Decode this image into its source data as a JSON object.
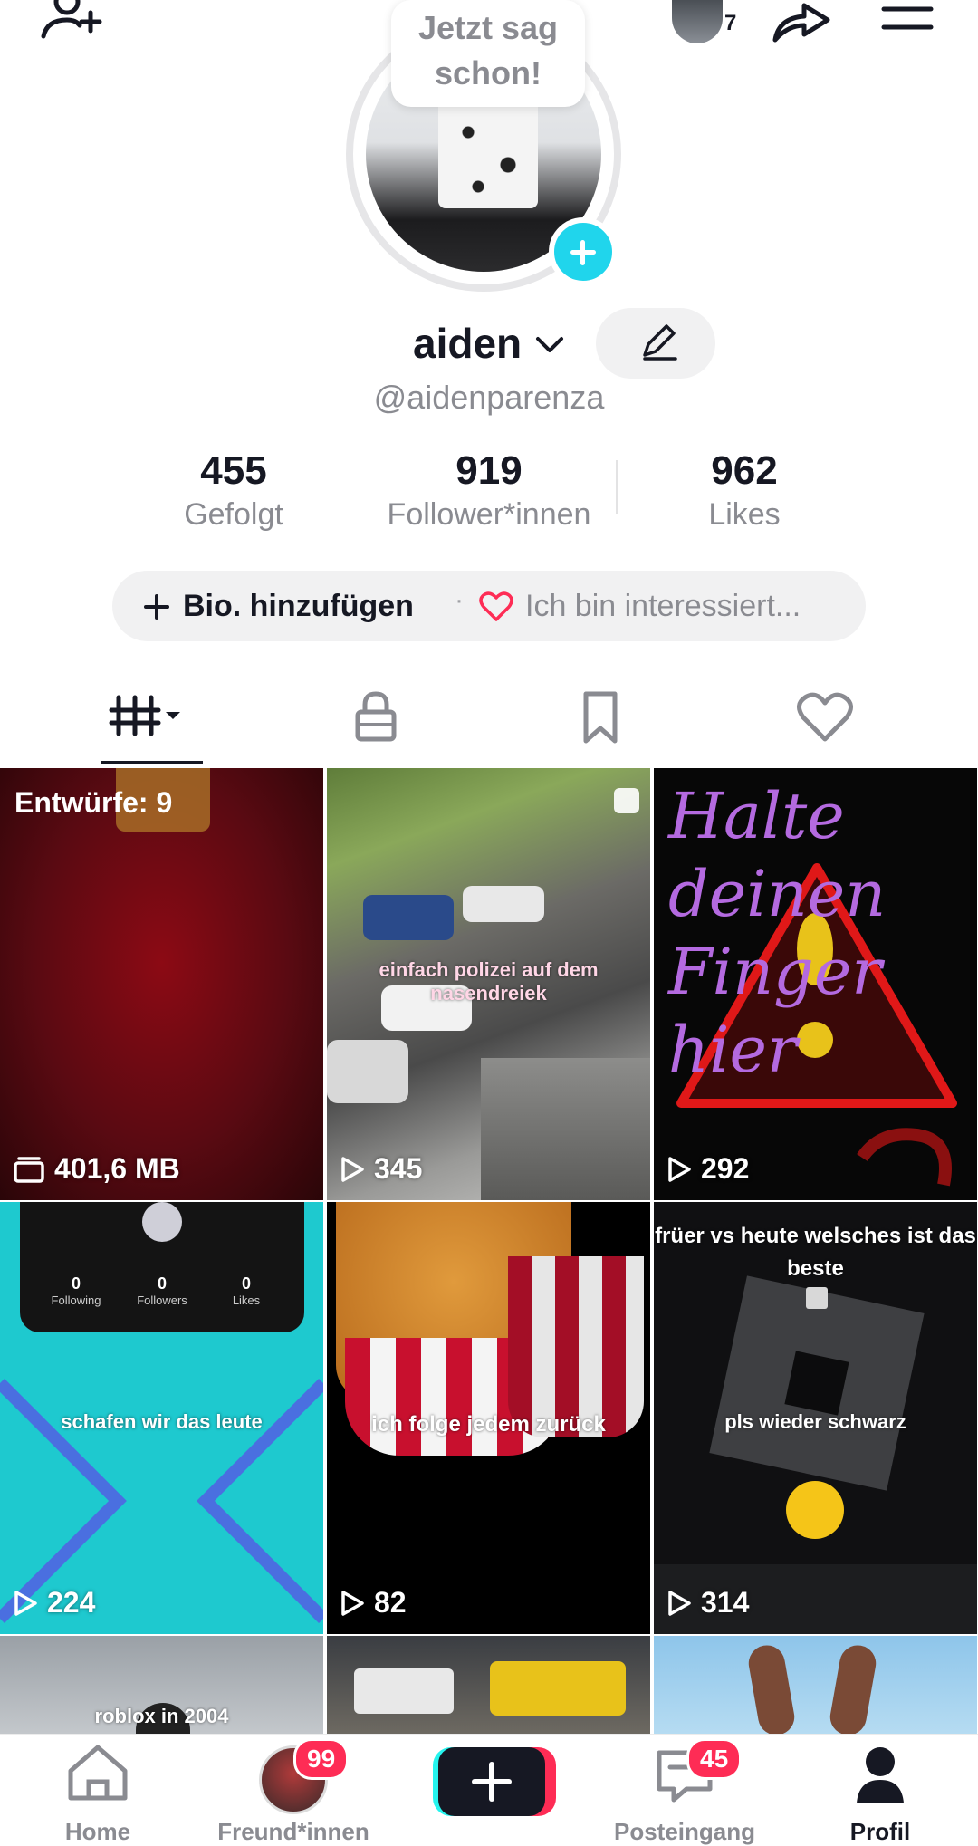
{
  "top_bar": {
    "story_count": "7"
  },
  "profile": {
    "bubble_text": "Jetzt sag schon!",
    "display_name": "aiden",
    "username": "@aidenparenza"
  },
  "stats": [
    {
      "value": "455",
      "label": "Gefolgt"
    },
    {
      "value": "919",
      "label": "Follower*innen"
    },
    {
      "value": "962",
      "label": "Likes"
    }
  ],
  "bio": {
    "add_label": "Bio. hinzufügen",
    "separator": "·",
    "interest_label": "Ich bin interessiert..."
  },
  "tabs": [
    {
      "icon": "videos-grid-icon"
    },
    {
      "icon": "lock-icon"
    },
    {
      "icon": "bookmark-icon"
    },
    {
      "icon": "heart-icon"
    }
  ],
  "grid": {
    "drafts_label": "Entwürfe: 9",
    "drafts_size": "401,6 MB",
    "videos": [
      {
        "caption": "einfach polizei auf dem nasendreiek",
        "views": "345"
      },
      {
        "caption": "Halte deinen Finger hier",
        "views": "292"
      },
      {
        "caption": "schafen wir das leute",
        "views": "224",
        "mini_stats": [
          "0",
          "0",
          "0"
        ],
        "mini_labels": [
          "Following",
          "Followers",
          "Likes"
        ]
      },
      {
        "caption": "ich folge jedem zurück",
        "views": "82"
      },
      {
        "caption_top": "früer vs heute welsches ist das beste",
        "caption": "pls wieder schwarz",
        "views": "314"
      },
      {
        "caption": "roblox in 2004"
      }
    ]
  },
  "bottom_nav": {
    "home": "Home",
    "friends": "Freund*innen",
    "friends_badge": "99",
    "inbox": "Posteingang",
    "inbox_badge": "45",
    "profile": "Profil"
  },
  "colors": {
    "accent_cyan": "#20d5ec",
    "badge_red": "#fe2c55",
    "text_primary": "#161823",
    "text_secondary": "#8a8b91"
  }
}
